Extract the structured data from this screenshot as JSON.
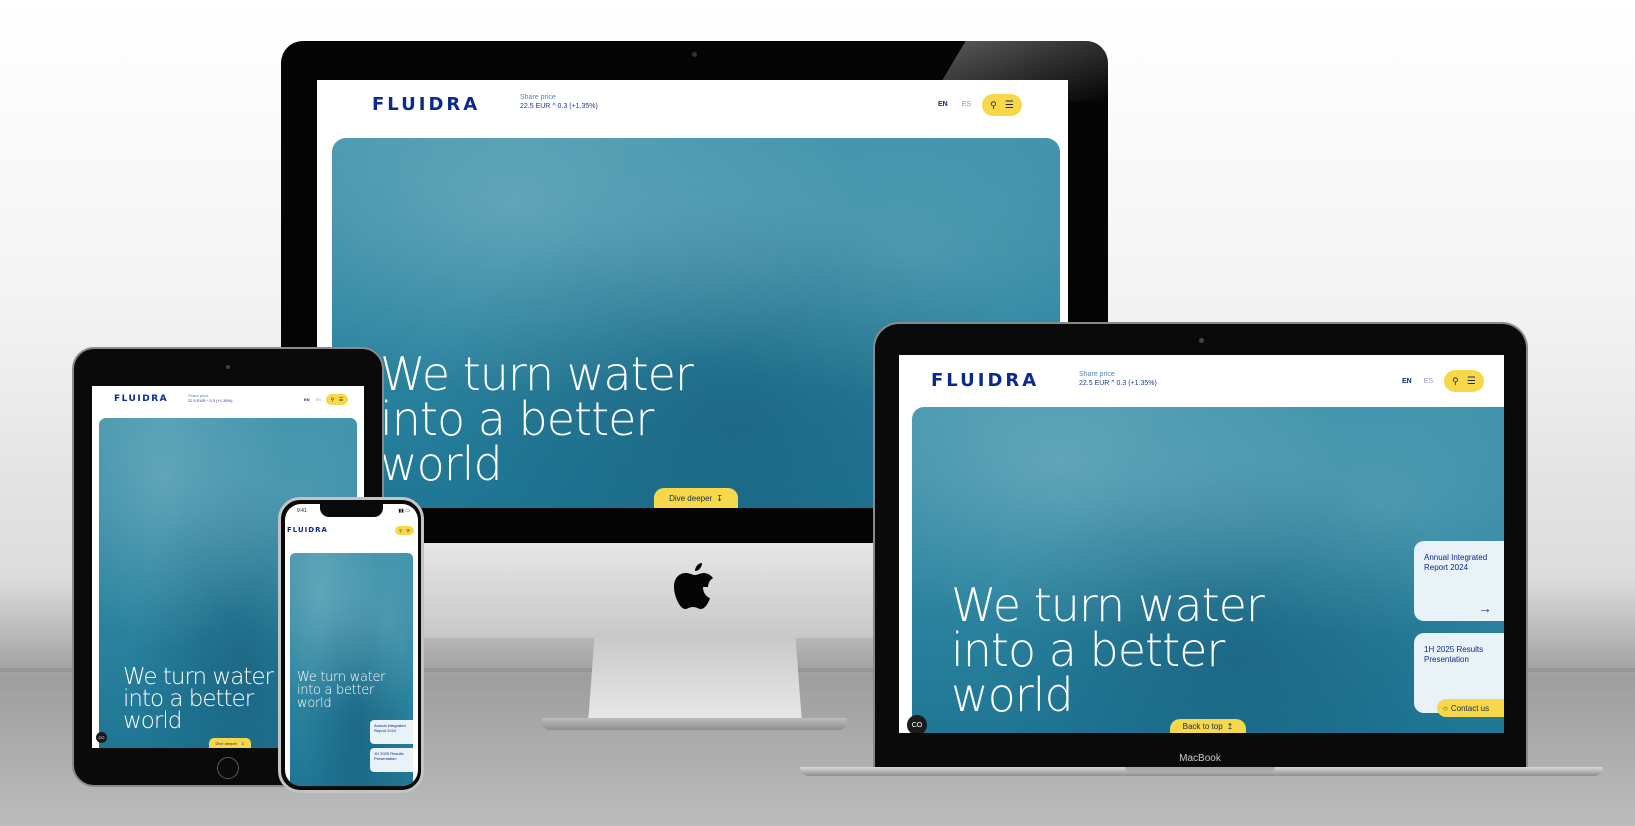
{
  "brand": {
    "logo_text": "FLUIDRA",
    "colors": {
      "navy": "#0b2a8c",
      "yellow": "#f6d84a",
      "water": "#2f87a2"
    }
  },
  "share": {
    "label": "Share price",
    "price": "22.5 EUR",
    "change": "^ 0.3 (+1.35%)",
    "ipad_price": "22.5 EUR",
    "ipad_change": "^ 0.3 (+1.35%)"
  },
  "languages": {
    "active": "EN",
    "other": "ES"
  },
  "header_icons": {
    "search": "search-icon",
    "menu": "menu-icon"
  },
  "hero": {
    "line1": "We turn water",
    "line2": "into a better",
    "line3": "world"
  },
  "buttons": {
    "dive_deeper": "Dive deeper",
    "back_to_top": "Back to top",
    "contact_us": "Contact us"
  },
  "cards": [
    {
      "title": "Annual Integrated Report 2024"
    },
    {
      "title": "1H 2025 Results Presentation"
    }
  ],
  "cookie_icon": "CO",
  "phone_status": {
    "time": "9:41"
  },
  "macbook_label": "MacBook"
}
